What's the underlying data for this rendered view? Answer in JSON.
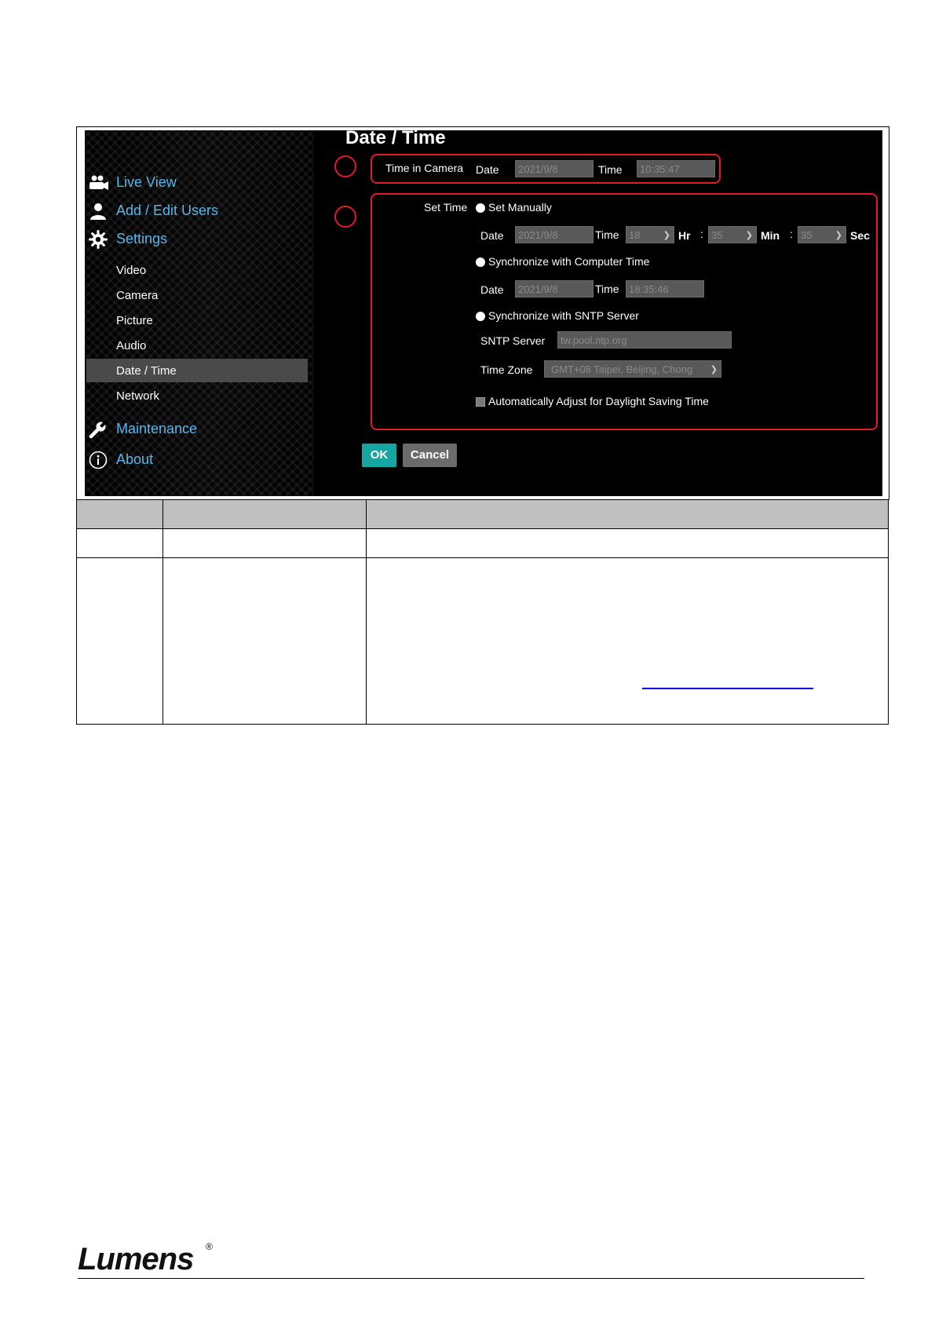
{
  "sidebar": {
    "main_items": [
      {
        "label": "Live View",
        "icon": "camera-group-icon"
      },
      {
        "label": "Add / Edit Users",
        "icon": "user-icon"
      },
      {
        "label": "Settings",
        "icon": "gear-icon"
      }
    ],
    "sub_items": [
      {
        "label": "Video"
      },
      {
        "label": "Camera"
      },
      {
        "label": "Picture"
      },
      {
        "label": "Audio"
      },
      {
        "label": "Date / Time",
        "active": true
      },
      {
        "label": "Network"
      }
    ],
    "bottom_items": [
      {
        "label": "Maintenance",
        "icon": "wrench-icon"
      },
      {
        "label": "About",
        "icon": "info-icon"
      }
    ]
  },
  "page": {
    "title": "Date / Time",
    "time_in_camera": {
      "label": "Time in Camera",
      "date_label": "Date",
      "date_value": "2021/9/8",
      "time_label": "Time",
      "time_value": "10:35:47"
    },
    "set_time": {
      "label": "Set Time",
      "manual": {
        "option_label": "Set Manually",
        "date_label": "Date",
        "date_value": "2021/9/8",
        "time_label": "Time",
        "hour_value": "18",
        "hour_unit": "Hr",
        "minute_value": "35",
        "minute_unit": "Min",
        "second_value": "35",
        "second_unit": "Sec",
        "separator": ":"
      },
      "computer": {
        "option_label": "Synchronize with Computer Time",
        "date_label": "Date",
        "date_value": "2021/9/8",
        "time_label": "Time",
        "time_value": "18:35:46"
      },
      "sntp": {
        "option_label": "Synchronize with SNTP Server",
        "server_label": "SNTP Server",
        "server_value": "tw.pool.ntp.org",
        "timezone_label": "Time Zone",
        "timezone_value": "GMT+08 Taipei, Beijing, Chong"
      },
      "dst_label": "Automatically Adjust for Daylight Saving Time"
    },
    "buttons": {
      "ok": "OK",
      "cancel": "Cancel"
    }
  },
  "footer": {
    "logo": "Lumens",
    "registered": "®"
  },
  "colors": {
    "accent_blue": "#59b6ea",
    "callout_red": "#e01b24",
    "ok_teal": "#15a6a1"
  }
}
